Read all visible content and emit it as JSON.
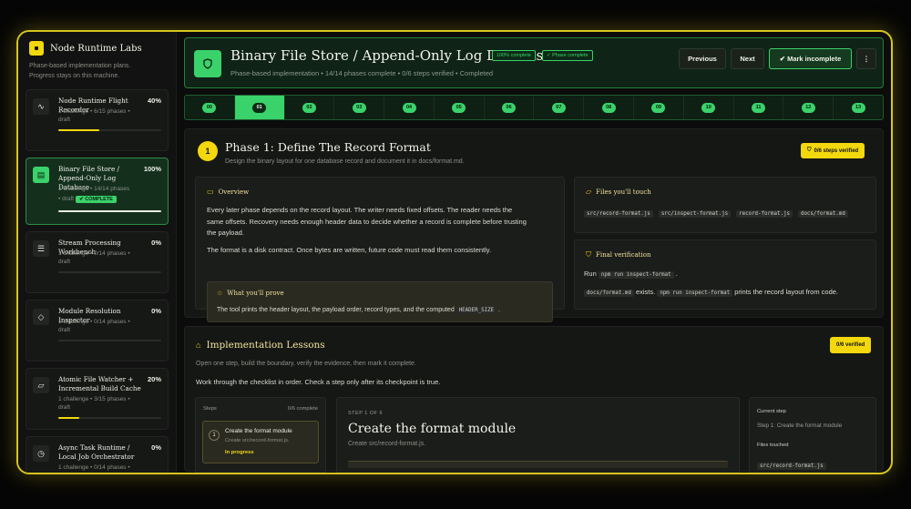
{
  "brand": {
    "title": "Node Runtime Labs",
    "subtitle_line1": "Phase-based implementation plans.",
    "subtitle_line2": "Progress stays on this machine."
  },
  "projects": [
    {
      "name": "Node Runtime Flight Recorder",
      "pct": "40%",
      "meta": "1 challenge • 6/15 phases •",
      "status": "draft",
      "progress": 0.4,
      "icon": "pulse-icon"
    },
    {
      "name": "Binary File Store / Append-Only Log Database",
      "pct": "100%",
      "meta": "1 challenge • 14/14 phases",
      "status": "• draft",
      "badge": "✔ COMPLETE",
      "progress": 1.0,
      "icon": "database-icon"
    },
    {
      "name": "Stream Processing Workbench",
      "pct": "0%",
      "meta": "1 challenge • 0/14 phases •",
      "status": "draft",
      "progress": 0,
      "icon": "sliders-icon"
    },
    {
      "name": "Module Resolution Inspector",
      "pct": "0%",
      "meta": "1 challenge • 0/14 phases •",
      "status": "draft",
      "progress": 0,
      "icon": "tag-icon"
    },
    {
      "name": "Atomic File Watcher + Incremental Build Cache",
      "pct": "20%",
      "meta": "1 challenge • 3/15 phases •",
      "status": "draft",
      "progress": 0.2,
      "icon": "folder-icon"
    },
    {
      "name": "Async Task Runtime / Local Job Orchestrator",
      "pct": "0%",
      "meta": "1 challenge • 0/14 phases •",
      "status": "draft",
      "progress": 0,
      "icon": "clock-icon"
    }
  ],
  "header": {
    "title": "Binary File Store / Append-Only Log Database",
    "badge_complete": "100% complete",
    "badge_phase": "✓ Phase complete",
    "subtitle": "Phase-based implementation • 14/14 phases complete • 0/6 steps verified • Completed",
    "previous": "Previous",
    "next": "Next",
    "mark_incomplete": "✔ Mark incomplete",
    "more": "⋮"
  },
  "phases": [
    "00",
    "01",
    "02",
    "03",
    "04",
    "05",
    "06",
    "07",
    "08",
    "09",
    "10",
    "11",
    "12",
    "13"
  ],
  "active_phase": 1,
  "phase": {
    "number": "1",
    "title": "Phase 1: Define The Record Format",
    "description": "Design the binary layout for one database record and document it in docs/format.md.",
    "steps_badge": "0/6 steps verified",
    "overview_title": "Overview",
    "overview_p1_l1": "Every later phase depends on the record layout. The writer needs fixed offsets. The reader needs the",
    "overview_p1_l2": "same offsets. Recovery needs enough header data to decide whether a record is complete before trusting",
    "overview_p1_l3": "the payload.",
    "overview_p2": "The format is a disk contract. Once bytes are written, future code must read them consistently.",
    "prove_title": "What you'll prove",
    "prove_text": "The tool prints the header layout, the payload order, record types, and the computed",
    "prove_code": "HEADER_SIZE",
    "files_title": "Files you'll touch",
    "files": [
      "src/record-format.js",
      "src/inspect-format.js",
      "record-format.js",
      "docs/format.md"
    ],
    "verify_title": "Final verification",
    "verify_run": "Run",
    "verify_cmd": "npm run inspect-format",
    "verify_doc": "docs/format.md",
    "verify_exists": "exists.",
    "verify_cmd2": "npm run inspect-format",
    "verify_tail": "prints the record layout from code."
  },
  "lessons": {
    "title": "Implementation Lessons",
    "subtitle": "Open one step, build the boundary, verify the evidence, then mark it complete.",
    "instruction": "Work through the checklist in order. Check a step only after its checkpoint is true.",
    "badge": "0/6 verified",
    "steps_label": "Steps",
    "steps_count": "0/6 complete",
    "step_num": "1",
    "step_title": "Create the format module",
    "step_file": "Create src/record-format.js.",
    "step_state": "In progress",
    "detail_kicker": "STEP 1 OF 6",
    "detail_title": "Create the format module",
    "detail_sub": "Create src/record-format.js.",
    "current_label": "Current step",
    "current_value": "Step 1: Create the format module",
    "files_touched_label": "Files touched",
    "files_touched_value": "src/record-format.js"
  }
}
